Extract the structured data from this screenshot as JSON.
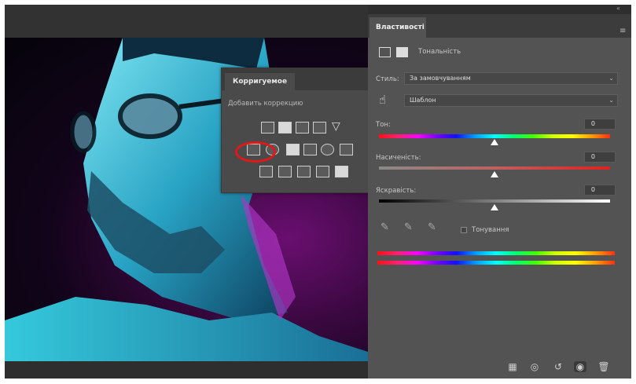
{
  "adjustments_panel": {
    "tab_label": "Корригуемое",
    "subtitle": "Добавить коррекцию"
  },
  "properties_panel": {
    "tab_label": "Властивості",
    "layer_type_label": "Тональність",
    "style_label": "Стиль:",
    "style_value": "За замовчуванням",
    "channel_value": "Шаблон",
    "hue_label": "Тон:",
    "hue_value": "0",
    "saturation_label": "Насиченість:",
    "saturation_value": "0",
    "lightness_label": "Яскравість:",
    "lightness_value": "0",
    "colorize_label": "Тонування"
  },
  "slider_levels": {
    "hue": 0.5,
    "saturation": 0.5,
    "lightness": 0.5
  },
  "icons": [
    "hand-target-icon",
    "eyedropper-icon",
    "eyedropper-plus-icon",
    "eyedropper-minus-icon",
    "clip-to-layer-icon",
    "view-previous-icon",
    "reset-icon",
    "visibility-eye-icon",
    "trash-icon",
    "panel-menu-icon"
  ],
  "colors": {
    "highlight_ring": "#e01818",
    "panel_bg": "#535353",
    "canvas_glow": "#6a0f70"
  }
}
